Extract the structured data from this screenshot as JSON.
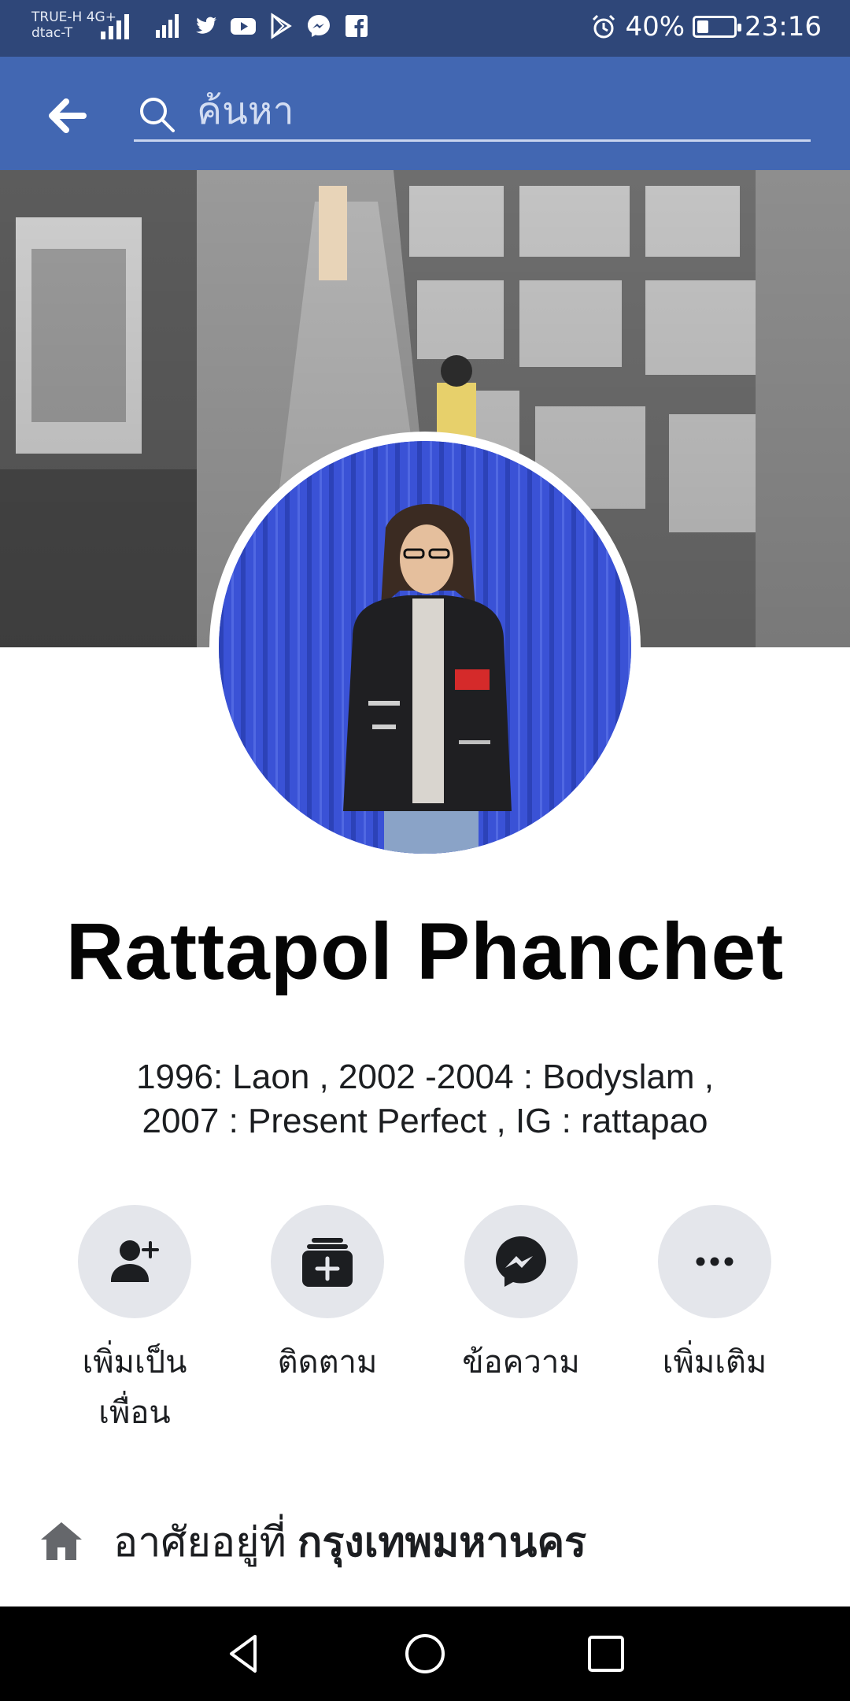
{
  "status": {
    "carrier1": "TRUE-H",
    "net1": "4G+",
    "carrier2": "dtac-T",
    "battery_text": "40%",
    "battery_level": 0.4,
    "time": "23:16",
    "apps": [
      "twitter-icon",
      "youtube-icon",
      "play-store-icon",
      "messenger-icon",
      "facebook-icon"
    ]
  },
  "header": {
    "search_placeholder": "ค้นหา"
  },
  "profile": {
    "name": "Rattapol Phanchet",
    "bio": "1996: Laon , 2002 -2004 : Bodyslam ,\n2007 : Present Perfect  , IG : rattapao"
  },
  "actions": [
    {
      "label": "เพิ่มเป็น\nเพื่อน",
      "icon": "add-friend-icon"
    },
    {
      "label": "ติดตาม",
      "icon": "follow-icon"
    },
    {
      "label": "ข้อความ",
      "icon": "messenger-icon"
    },
    {
      "label": "เพิ่มเติม",
      "icon": "more-icon"
    }
  ],
  "lives_in": {
    "prefix": "อาศัยอยู่ที่",
    "city": "กรุงเทพมหานคร"
  },
  "colors": {
    "header": "#4267b2",
    "status_bar": "#2f4779",
    "action_bg": "#e4e6eb",
    "avatar_bg": "#3b55d8"
  }
}
